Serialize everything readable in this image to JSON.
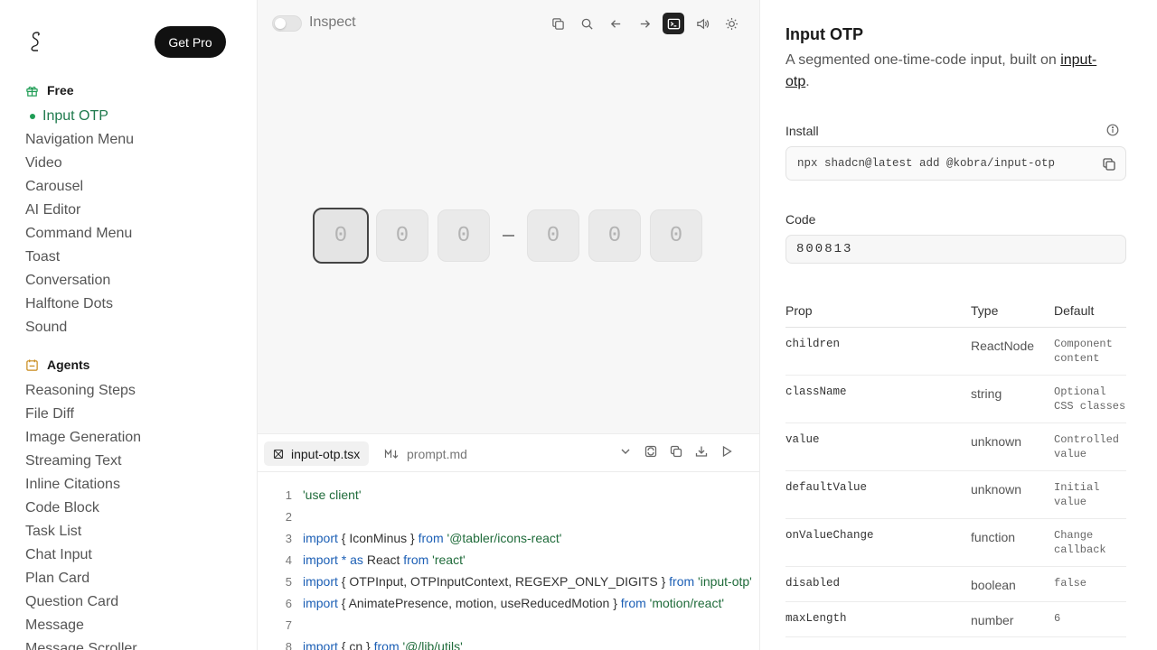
{
  "sidebar": {
    "get_pro": "Get Pro",
    "free_heading": "Free",
    "free_items": [
      "Input OTP",
      "Navigation Menu",
      "Video",
      "Carousel",
      "AI Editor",
      "Command Menu",
      "Toast",
      "Conversation",
      "Halftone Dots",
      "Sound"
    ],
    "active_item": "Input OTP",
    "agents_heading": "Agents",
    "agent_items": [
      "Reasoning Steps",
      "File Diff",
      "Image Generation",
      "Streaming Text",
      "Inline Citations",
      "Code Block",
      "Task List",
      "Chat Input",
      "Plan Card",
      "Question Card",
      "Message",
      "Message Scroller"
    ]
  },
  "preview": {
    "inspect_label": "Inspect",
    "toolbar_icons": [
      "copy-icon",
      "search-icon",
      "arrow-left-icon",
      "arrow-right-icon",
      "terminal-icon",
      "volume-icon",
      "sun-icon"
    ],
    "otp_digits": [
      "0",
      "0",
      "0",
      "0",
      "0",
      "0"
    ]
  },
  "code": {
    "tabs": [
      "input-otp.tsx",
      "prompt.md"
    ],
    "lines": [
      {
        "n": "1",
        "parts": [
          {
            "t": "'use client'",
            "c": "str"
          }
        ]
      },
      {
        "n": "2",
        "parts": []
      },
      {
        "n": "3",
        "parts": [
          {
            "t": "import",
            "c": "kw"
          },
          {
            "t": " { IconMinus } ",
            "c": "pl"
          },
          {
            "t": "from",
            "c": "kw"
          },
          {
            "t": " '@tabler/icons-react'",
            "c": "str"
          }
        ]
      },
      {
        "n": "4",
        "parts": [
          {
            "t": "import",
            "c": "kw"
          },
          {
            "t": " * ",
            "c": "kw"
          },
          {
            "t": "as",
            "c": "kw"
          },
          {
            "t": " React ",
            "c": "pl"
          },
          {
            "t": "from",
            "c": "kw"
          },
          {
            "t": " 'react'",
            "c": "str"
          }
        ]
      },
      {
        "n": "5",
        "parts": [
          {
            "t": "import",
            "c": "kw"
          },
          {
            "t": " { OTPInput, OTPInputContext, REGEXP_ONLY_DIGITS } ",
            "c": "pl"
          },
          {
            "t": "from",
            "c": "kw"
          },
          {
            "t": " 'input-otp'",
            "c": "str"
          }
        ]
      },
      {
        "n": "6",
        "parts": [
          {
            "t": "import",
            "c": "kw"
          },
          {
            "t": " { AnimatePresence, motion, useReducedMotion } ",
            "c": "pl"
          },
          {
            "t": "from",
            "c": "kw"
          },
          {
            "t": " 'motion/react'",
            "c": "str"
          }
        ]
      },
      {
        "n": "7",
        "parts": []
      },
      {
        "n": "8",
        "parts": [
          {
            "t": "import",
            "c": "kw"
          },
          {
            "t": " { cn } ",
            "c": "pl"
          },
          {
            "t": "from",
            "c": "kw"
          },
          {
            "t": " '@/lib/utils'",
            "c": "str"
          }
        ]
      }
    ]
  },
  "details": {
    "title": "Input OTP",
    "description_prefix": "A segmented one-time-code input, built on ",
    "description_link": "input-otp",
    "description_suffix": ".",
    "install_label": "Install",
    "install_command": "npx shadcn@latest add @kobra/input-otp",
    "code_label": "Code",
    "code_value": "800813",
    "table_headers": [
      "Prop",
      "Type",
      "Default"
    ],
    "props": [
      {
        "name": "children",
        "type": "ReactNode",
        "default": "Component content"
      },
      {
        "name": "className",
        "type": "string",
        "default": "Optional CSS classes"
      },
      {
        "name": "value",
        "type": "unknown",
        "default": "Controlled value"
      },
      {
        "name": "defaultValue",
        "type": "unknown",
        "default": "Initial value"
      },
      {
        "name": "onValueChange",
        "type": "function",
        "default": "Change callback"
      },
      {
        "name": "disabled",
        "type": "boolean",
        "default": "false"
      },
      {
        "name": "maxLength",
        "type": "number",
        "default": "6"
      }
    ]
  }
}
